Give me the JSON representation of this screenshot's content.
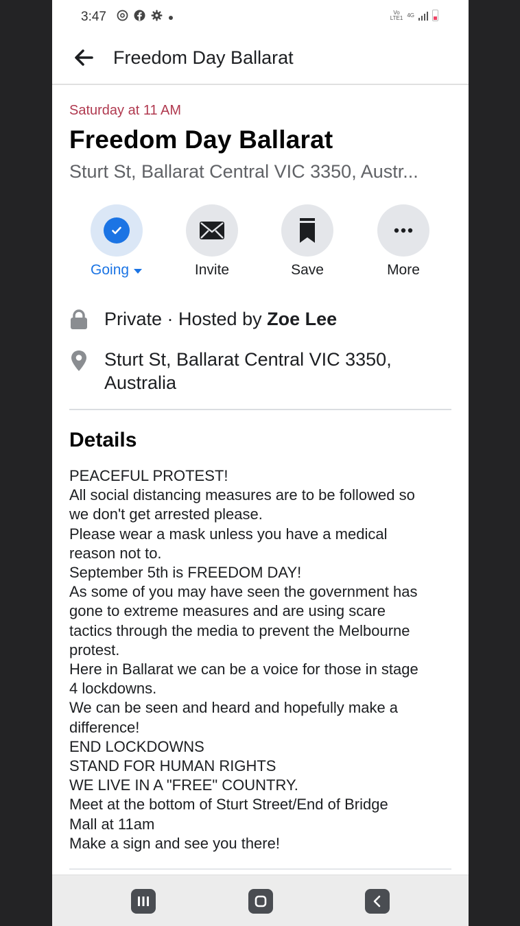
{
  "status_bar": {
    "time": "3:47",
    "icons": [
      "at-icon",
      "facebook-icon",
      "settings-icon",
      "dot-icon"
    ],
    "network_line1": "Vo",
    "network_line2": "LTE1",
    "network_4g": "4G"
  },
  "header": {
    "title": "Freedom Day Ballarat"
  },
  "event": {
    "date": "Saturday at 11 AM",
    "title": "Freedom Day Ballarat",
    "location": "Sturt St, Ballarat Central VIC 3350, Austr..."
  },
  "actions": [
    {
      "label": "Going",
      "icon": "check-icon",
      "active": true
    },
    {
      "label": "Invite",
      "icon": "envelope-icon"
    },
    {
      "label": "Save",
      "icon": "bookmark-icon"
    },
    {
      "label": "More",
      "icon": "more-icon"
    }
  ],
  "info": {
    "privacy": "Private · Hosted by ",
    "host": "Zoe Lee",
    "address_line1": "Sturt St, Ballarat Central VIC 3350,",
    "address_line2": "Australia"
  },
  "details": {
    "heading": "Details",
    "lines": [
      "PEACEFUL PROTEST!",
      "All social distancing measures are to be followed so",
      "we don't get arrested please.",
      "Please wear a mask unless you have a medical",
      "reason not to.",
      "September 5th is FREEDOM DAY!",
      "As some of you may have seen the government has",
      "gone to extreme measures and are using scare",
      "tactics through the media to prevent the Melbourne",
      "protest.",
      "Here in Ballarat we can be a voice for those in stage",
      "4 lockdowns.",
      "We can be seen and heard and hopefully make a",
      "difference!",
      "END LOCKDOWNS",
      "STAND FOR HUMAN RIGHTS",
      "WE LIVE IN A \"FREE\" COUNTRY.",
      "Meet at the bottom of Sturt Street/End of Bridge",
      "Mall at 11am",
      "Make a sign and see you there!"
    ]
  },
  "nav": [
    "recent-apps-icon",
    "home-icon",
    "back-nav-icon"
  ],
  "colors": {
    "accent": "#1b74e4",
    "date": "#b0394f",
    "background": "#232325"
  }
}
